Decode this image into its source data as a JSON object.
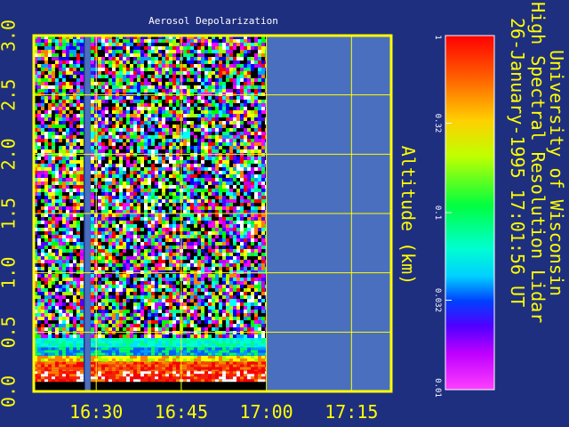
{
  "chart_data": {
    "type": "heatmap",
    "title": "Aerosol Depolarization",
    "ylabel": "Altitude (km)",
    "xlim": [
      "16:19",
      "17:22"
    ],
    "ylim": [
      0.0,
      3.0
    ],
    "x_ticks": [
      "16:30",
      "16:45",
      "17:00",
      "17:15"
    ],
    "y_ticks": [
      "0.0",
      "0.5",
      "1.0",
      "1.5",
      "2.0",
      "2.5",
      "3.0"
    ],
    "grid": true,
    "data_gap_interval": [
      "16:28",
      "16:29"
    ],
    "no_data_after": "17:00",
    "colorbar": {
      "scale": "log",
      "ticks": [
        "1",
        "0.32",
        "0.1",
        "0.032",
        "0.01"
      ],
      "range": [
        0.01,
        1
      ]
    },
    "depolarization_profile_summary": [
      {
        "altitude_range_km": [
          0.0,
          0.08
        ],
        "description": "no data (black)"
      },
      {
        "altitude_range_km": [
          0.08,
          0.25
        ],
        "typical_value": 1.0
      },
      {
        "altitude_range_km": [
          0.25,
          0.45
        ],
        "typical_value": 0.1
      },
      {
        "altitude_range_km": [
          0.45,
          3.0
        ],
        "typical_value": "noise across full range"
      }
    ]
  },
  "side_text": {
    "line1": "University of Wisconsin",
    "line2": "High Spectral Resolution Lidar",
    "line3": "26-January-1995 17:01:56 UT"
  },
  "colors": {
    "background": "#1f2f80",
    "frame": "#ffff00",
    "text": "#ffff00",
    "no_data_fill": "#4a6fbf",
    "title_text": "#ffffff"
  }
}
